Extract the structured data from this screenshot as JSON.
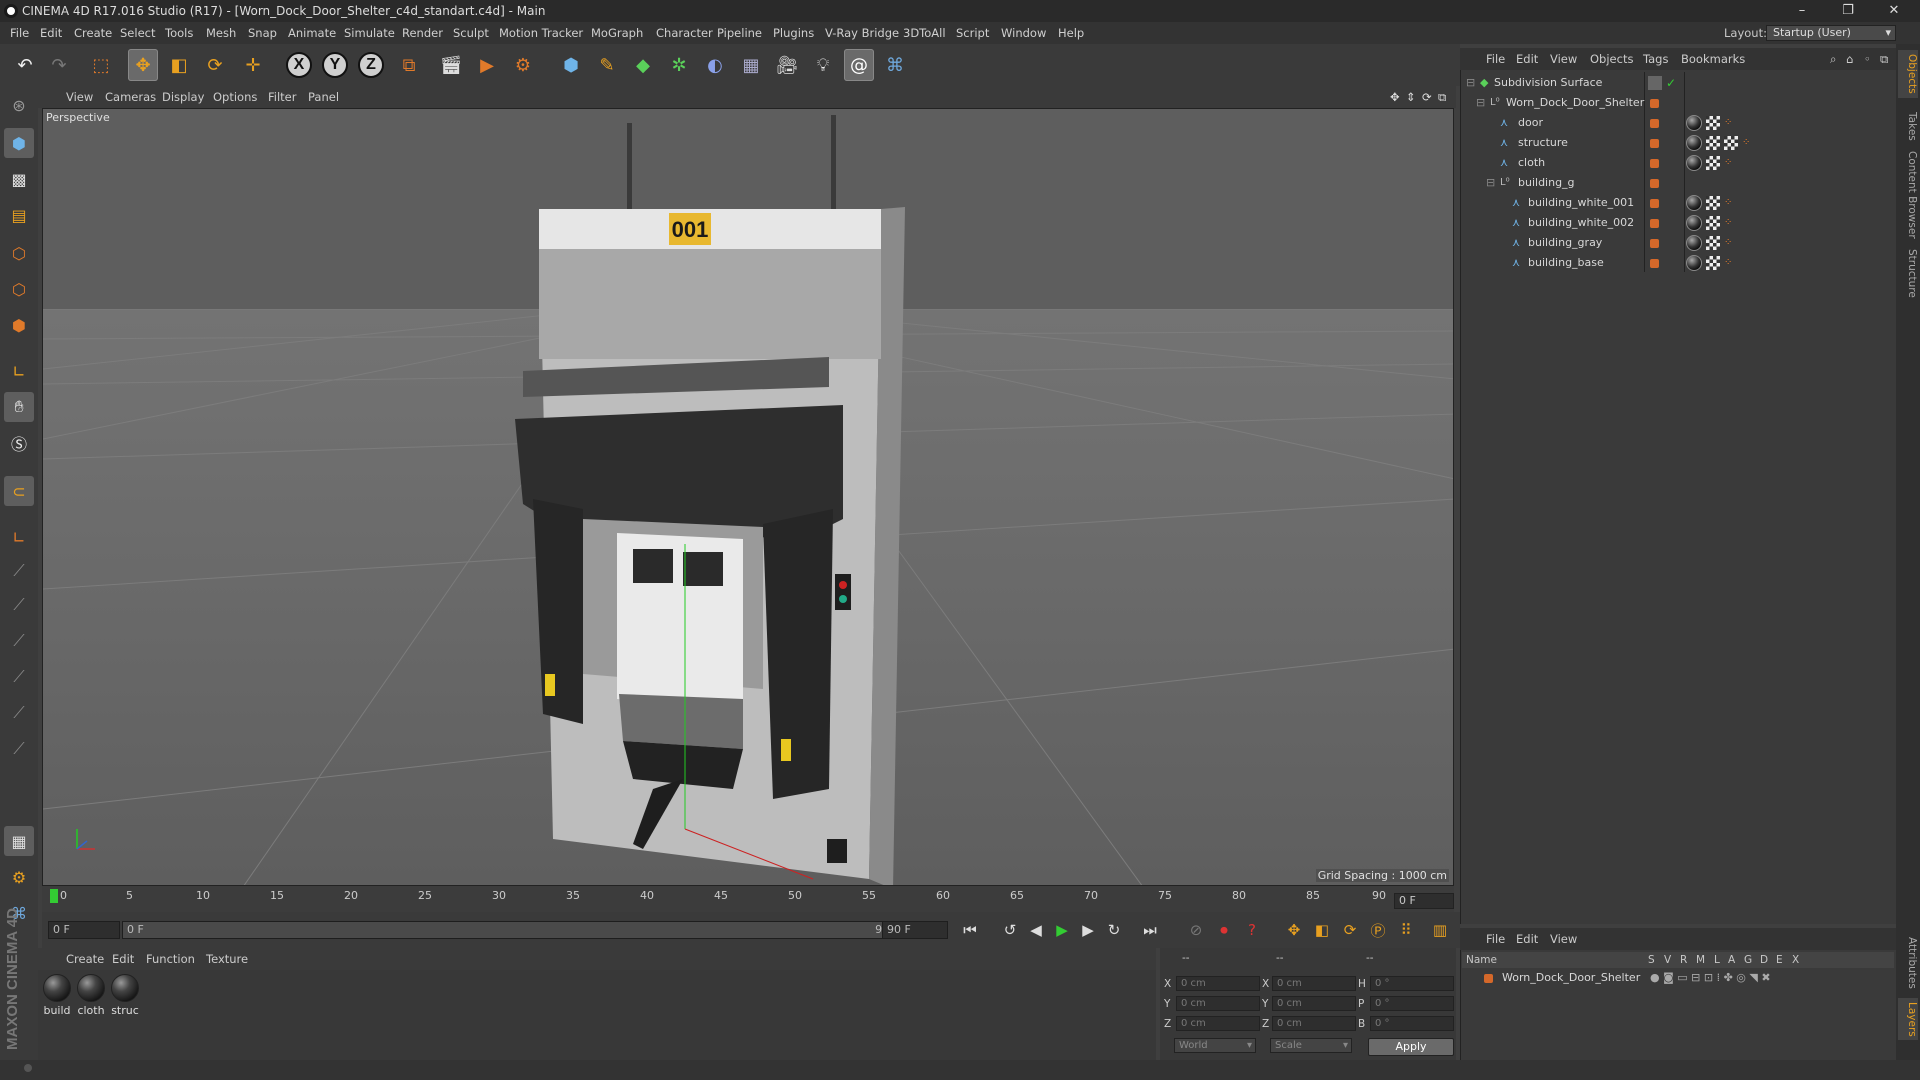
{
  "window": {
    "title": "CINEMA 4D R17.016 Studio (R17) - [Worn_Dock_Door_Shelter_c4d_standart.c4d] - Main",
    "minimize": "–",
    "maximize": "❐",
    "close": "✕"
  },
  "menu": [
    "File",
    "Edit",
    "Create",
    "Select",
    "Tools",
    "Mesh",
    "Snap",
    "Animate",
    "Simulate",
    "Render",
    "Sculpt",
    "Motion Tracker",
    "MoGraph",
    "Character",
    "Pipeline",
    "Plugins",
    "V-Ray Bridge",
    "3DToAll",
    "Script",
    "Window",
    "Help"
  ],
  "layout": {
    "label": "Layout:",
    "value": "Startup (User)"
  },
  "toolbar": {
    "axis_x": "X",
    "axis_y": "Y",
    "axis_z": "Z"
  },
  "viewport": {
    "menu": [
      "View",
      "Cameras",
      "Display",
      "Options",
      "Filter",
      "Panel"
    ],
    "label": "Perspective",
    "grid_spacing": "Grid Spacing : 1000 cm",
    "door_number": "001"
  },
  "timeline": {
    "ticks": [
      "0",
      "5",
      "10",
      "15",
      "20",
      "25",
      "30",
      "35",
      "40",
      "45",
      "50",
      "55",
      "60",
      "65",
      "70",
      "75",
      "80",
      "85",
      "90"
    ],
    "current_frame": "0 F"
  },
  "transport": {
    "start": "0 F",
    "range_start": "0 F",
    "range_end": "90 F",
    "end": "90 F"
  },
  "materials": {
    "menu": [
      "Create",
      "Edit",
      "Function",
      "Texture"
    ],
    "items": [
      "build",
      "cloth",
      "struc"
    ]
  },
  "coords": {
    "header_dash": [
      "--",
      "--",
      "--"
    ],
    "rows": [
      {
        "a": "X",
        "av": "0 cm",
        "b": "X",
        "bv": "0 cm",
        "c": "H",
        "cv": "0 °"
      },
      {
        "a": "Y",
        "av": "0 cm",
        "b": "Y",
        "bv": "0 cm",
        "c": "P",
        "cv": "0 °"
      },
      {
        "a": "Z",
        "av": "0 cm",
        "b": "Z",
        "bv": "0 cm",
        "c": "B",
        "cv": "0 °"
      }
    ],
    "space": "World",
    "mode": "Scale",
    "apply": "Apply"
  },
  "objects": {
    "menu": [
      "File",
      "Edit",
      "View",
      "Objects",
      "Tags",
      "Bookmarks"
    ],
    "tree": [
      {
        "name": "Subdivision Surface",
        "indent": 0,
        "type": "subdiv"
      },
      {
        "name": "Worn_Dock_Door_Shelter",
        "indent": 1,
        "type": "null"
      },
      {
        "name": "door",
        "indent": 2,
        "type": "poly"
      },
      {
        "name": "structure",
        "indent": 2,
        "type": "poly"
      },
      {
        "name": "cloth",
        "indent": 2,
        "type": "poly"
      },
      {
        "name": "building_g",
        "indent": 2,
        "type": "null"
      },
      {
        "name": "building_white_001",
        "indent": 3,
        "type": "poly"
      },
      {
        "name": "building_white_002",
        "indent": 3,
        "type": "poly"
      },
      {
        "name": "building_gray",
        "indent": 3,
        "type": "poly"
      },
      {
        "name": "building_base",
        "indent": 3,
        "type": "poly"
      }
    ]
  },
  "layers": {
    "menu": [
      "File",
      "Edit",
      "View"
    ],
    "columns": [
      "Name",
      "S",
      "V",
      "R",
      "M",
      "L",
      "A",
      "G",
      "D",
      "E",
      "X"
    ],
    "rows": [
      "Worn_Dock_Door_Shelter"
    ]
  },
  "side_tabs": [
    "Objects",
    "Takes",
    "Content Browser",
    "Structure",
    "Attributes",
    "Layers"
  ],
  "branding": "MAXON CINEMA 4D"
}
